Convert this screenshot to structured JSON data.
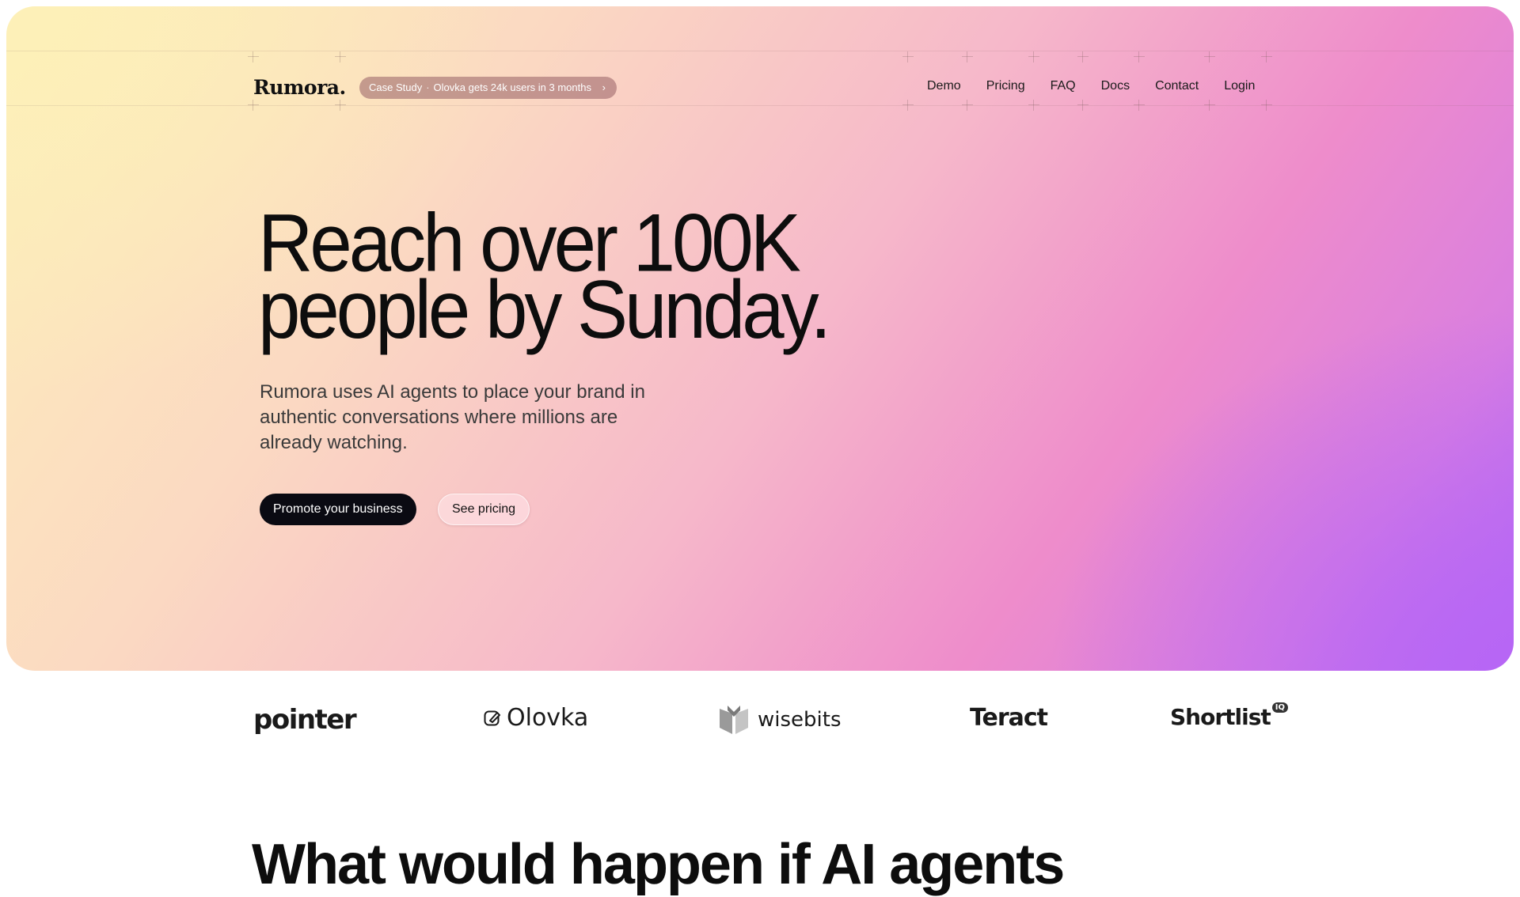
{
  "brand": {
    "name": "Rumora",
    "dot": "."
  },
  "announcement": {
    "label": "Case Study",
    "separator": "·",
    "text": "Olovka gets 24k users in 3 months",
    "chevron": "›"
  },
  "nav": {
    "items": [
      "Demo",
      "Pricing",
      "FAQ",
      "Docs",
      "Contact",
      "Login"
    ]
  },
  "hero": {
    "headline_line1": "Reach over 100K",
    "headline_line2": "people by Sunday.",
    "subtitle": "Rumora uses AI agents to place your brand in authentic conversations where millions are already watching.",
    "primary_cta": "Promote your business",
    "secondary_cta": "See pricing"
  },
  "logos": {
    "items": [
      {
        "name": "pointer",
        "icon": ""
      },
      {
        "name": "Olovka",
        "icon": "pencil-square-icon"
      },
      {
        "name": "wisebits",
        "icon": "shield-book-icon"
      },
      {
        "name": "Teract",
        "icon": ""
      },
      {
        "name": "Shortlist",
        "badge": "IQ"
      }
    ]
  },
  "next_section": {
    "heading": "What would happen if AI agents"
  },
  "colors": {
    "gradient_start": "#fdefba",
    "gradient_mid": "#ee8ccb",
    "gradient_end": "#b56af4",
    "primary_button": "#0a0a12",
    "pill_bg": "#a66b70"
  }
}
